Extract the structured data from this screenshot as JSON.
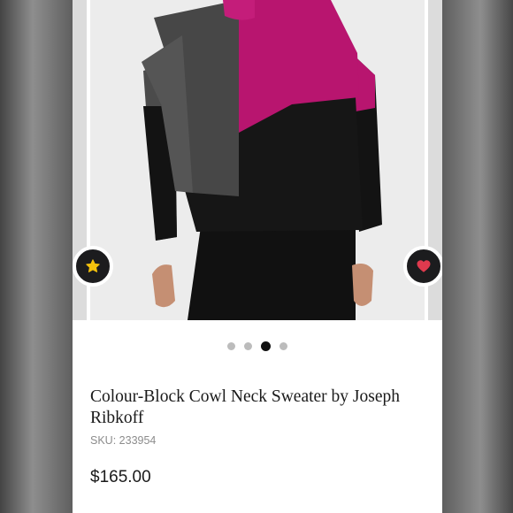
{
  "product": {
    "title": "Colour-Block Cowl Neck Sweater by Joseph Ribkoff",
    "sku_label": "SKU:",
    "sku_value": "233954",
    "price": "$165.00"
  },
  "carousel": {
    "slide_count": 4,
    "active_index": 2
  },
  "icons": {
    "favorite_star": "star-icon",
    "wishlist_heart": "heart-icon"
  },
  "colors": {
    "star": "#f4c20d",
    "heart": "#e03a4e",
    "sweater_pink": "#b8156f",
    "sweater_grey": "#4b4b4b",
    "button_bg": "#1c1c1e"
  }
}
